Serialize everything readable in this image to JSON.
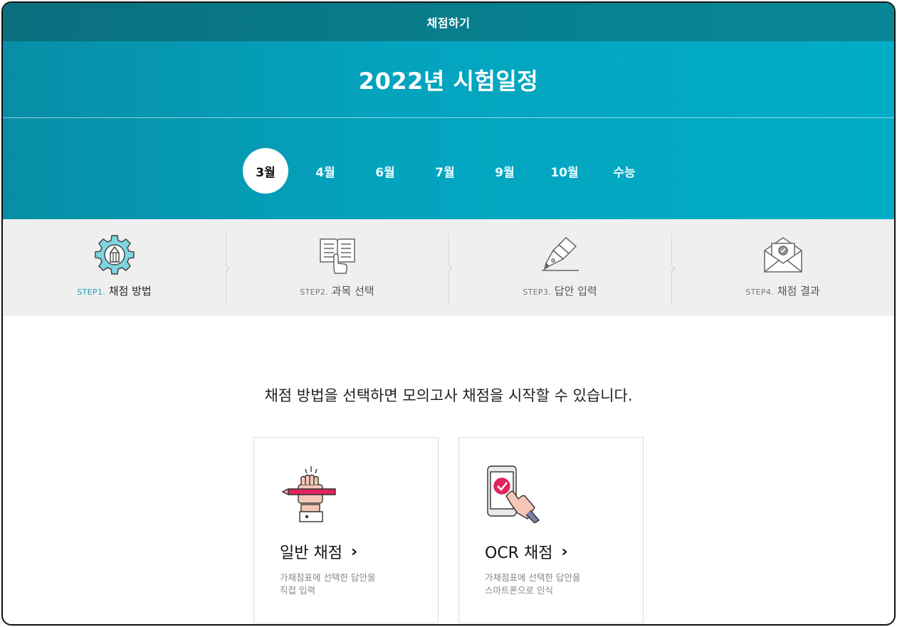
{
  "header": {
    "title": "채점하기"
  },
  "hero": {
    "title": "2022년 시험일정"
  },
  "months": [
    {
      "label": "3월",
      "active": true
    },
    {
      "label": "4월",
      "active": false
    },
    {
      "label": "6월",
      "active": false
    },
    {
      "label": "7월",
      "active": false
    },
    {
      "label": "9월",
      "active": false
    },
    {
      "label": "10월",
      "active": false
    },
    {
      "label": "수능",
      "active": false
    }
  ],
  "steps": [
    {
      "num": "STEP1.",
      "label": "채점 방법",
      "icon": "gear-pencil-icon",
      "active": true
    },
    {
      "num": "STEP2.",
      "label": "과목 선택",
      "icon": "book-hand-icon",
      "active": false
    },
    {
      "num": "STEP3.",
      "label": "답안 입력",
      "icon": "pen-nib-icon",
      "active": false
    },
    {
      "num": "STEP4.",
      "label": "채점 결과",
      "icon": "envelope-check-icon",
      "active": false
    }
  ],
  "intro": "채점 방법을 선택하면 모의고사 채점을 시작할 수 있습니다.",
  "cards": [
    {
      "title": "일반 채점",
      "desc1": "가채점표에 선택한 답안을",
      "desc2": "직접 입력",
      "icon": "hand-pen-icon"
    },
    {
      "title": "OCR 채점",
      "desc1": "가채점표에 선택한 답안을",
      "desc2": "스마트폰으로 인식",
      "icon": "phone-touch-icon"
    }
  ],
  "colors": {
    "accent": "#04a4bf",
    "header": "#07808f",
    "step_bg": "#efefef",
    "pen_red": "#e0245e"
  }
}
